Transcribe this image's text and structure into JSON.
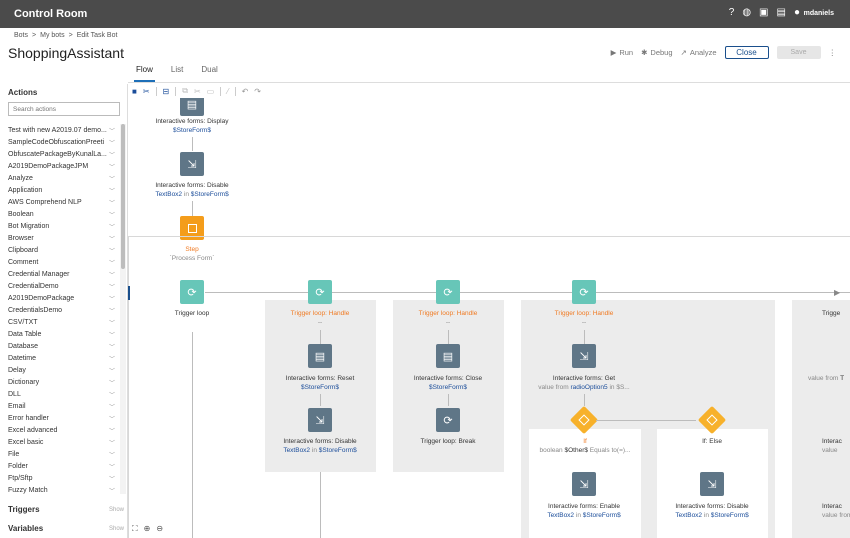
{
  "app": {
    "title": "Control Room",
    "user": "mdaniels"
  },
  "breadcrumb": [
    "Bots",
    "My bots",
    "Edit Task Bot"
  ],
  "page_title": "ShoppingAssistant",
  "toolbar": {
    "run": "Run",
    "debug": "Debug",
    "analyze": "Analyze",
    "close": "Close",
    "save": "Save"
  },
  "tabs": [
    "Flow",
    "List",
    "Dual"
  ],
  "sidebar": {
    "heading": "Actions",
    "search_placeholder": "Search actions",
    "items": [
      "Test with new A2019.07 demo...",
      "SampleCodeObfuscationPreeti",
      "ObfuscatePackageByKunalLa...",
      "A2019DemoPackageJPM",
      "Analyze",
      "Application",
      "AWS Comprehend NLP",
      "Boolean",
      "Bot Migration",
      "Browser",
      "Clipboard",
      "Comment",
      "Credential Manager",
      "CredentialDemo",
      "A2019DemoPackage",
      "CredentialsDemo",
      "CSV/TXT",
      "Data Table",
      "Database",
      "Datetime",
      "Delay",
      "Dictionary",
      "DLL",
      "Email",
      "Error handler",
      "Excel advanced",
      "Excel basic",
      "File",
      "Folder",
      "Ftp/Sftp",
      "Fuzzy Match"
    ],
    "triggers": "Triggers",
    "variables": "Variables",
    "show": "Show"
  },
  "flow": {
    "display_title": "Interactive forms: Display",
    "display_var": "$StoreForm$",
    "disable_title": "Interactive forms: Disable",
    "disable_var": "TextBox2",
    "in": "in",
    "disable_form": "$StoreForm$",
    "step_title": "Step",
    "step_name": "`Process Form`",
    "trigger_loop": "Trigger loop",
    "handle": "Trigger loop: Handle",
    "dashes": "--",
    "reset_title": "Interactive forms: Reset",
    "reset_var": "$StoreForm$",
    "disable2_title": "Interactive forms: Disable",
    "disable2_var": "TextBox2",
    "disable2_form": "$StoreForm$",
    "close_title": "Interactive forms: Close",
    "close_var": "$StoreForm$",
    "break_title": "Trigger loop: Break",
    "get_title": "Interactive forms: Get",
    "get_value_from": "value from",
    "get_var": "radioOption5",
    "get_in": "in $S...",
    "if_title": "If",
    "if_bool": "boolean",
    "if_var": "$Other$",
    "if_cond": "Equals to(=)...",
    "else_title": "If: Else",
    "enable_title": "Interactive forms: Enable",
    "enable_var": "TextBox2",
    "enable_form": "$StoreForm$",
    "disable3_title": "Interactive forms: Disable",
    "disable3_var": "TextBox2",
    "disable3_form": "$StoreForm$",
    "cut_trigger": "Trigge",
    "cut_value_from": "value from",
    "cut_t": "T",
    "cut_interac": "Interac",
    "cut_value_from_t": "value from T",
    "cut_value": "value",
    "cut_interac2": "Interac",
    "cut_value_from_r": "value from R"
  },
  "colors": {
    "accent": "#1d6fb8",
    "slate": "#5f7687",
    "teal": "#67c6b8",
    "orange": "#f49d1b"
  }
}
